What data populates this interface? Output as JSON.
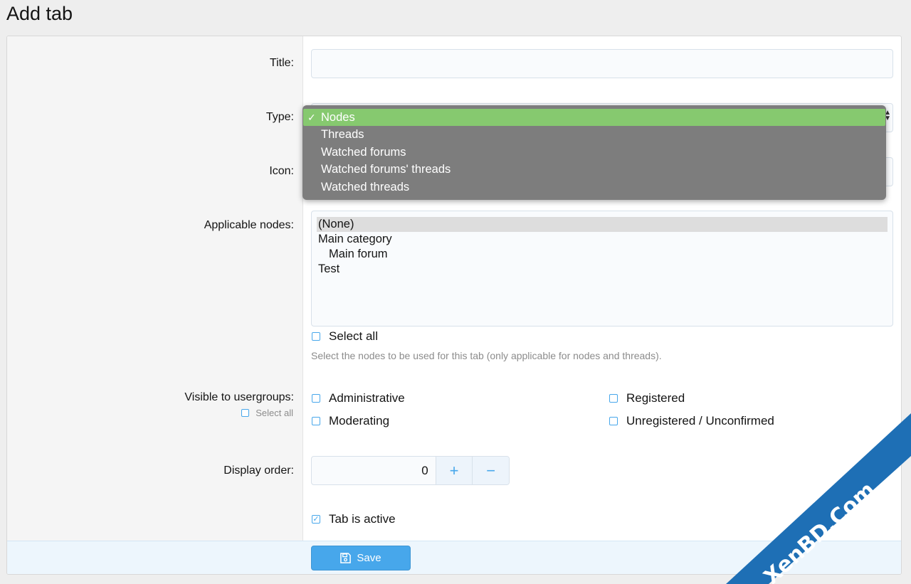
{
  "page": {
    "title": "Add tab"
  },
  "form": {
    "title": {
      "label": "Title:",
      "value": ""
    },
    "type": {
      "label": "Type:",
      "options": [
        {
          "label": "Nodes",
          "selected": true
        },
        {
          "label": "Threads",
          "selected": false
        },
        {
          "label": "Watched forums",
          "selected": false
        },
        {
          "label": "Watched forums' threads",
          "selected": false
        },
        {
          "label": "Watched threads",
          "selected": false
        }
      ]
    },
    "icon": {
      "label": "Icon:"
    },
    "applicable_nodes": {
      "label": "Applicable nodes:",
      "options": [
        {
          "label": "(None)",
          "selected": true,
          "indent": 0
        },
        {
          "label": "Main category",
          "selected": false,
          "indent": 0
        },
        {
          "label": "Main forum",
          "selected": false,
          "indent": 1
        },
        {
          "label": "Test",
          "selected": false,
          "indent": 0
        }
      ],
      "select_all": "Select all",
      "hint": "Select the nodes to be used for this tab (only applicable for nodes and threads)."
    },
    "usergroups": {
      "label": "Visible to usergroups:",
      "select_all": "Select all",
      "groups": [
        {
          "label": "Administrative",
          "checked": false
        },
        {
          "label": "Registered",
          "checked": false
        },
        {
          "label": "Moderating",
          "checked": false
        },
        {
          "label": "Unregistered / Unconfirmed",
          "checked": false
        }
      ]
    },
    "display_order": {
      "label": "Display order:",
      "value": "0",
      "plus": "+",
      "minus": "−"
    },
    "active": {
      "label": "Tab is active",
      "checked": true
    },
    "save_label": "Save"
  },
  "watermark": {
    "text": "XenBD.Com",
    "color": "#1e6fb5"
  },
  "colors": {
    "accent": "#47a7eb",
    "highlight": "#86c96f"
  }
}
